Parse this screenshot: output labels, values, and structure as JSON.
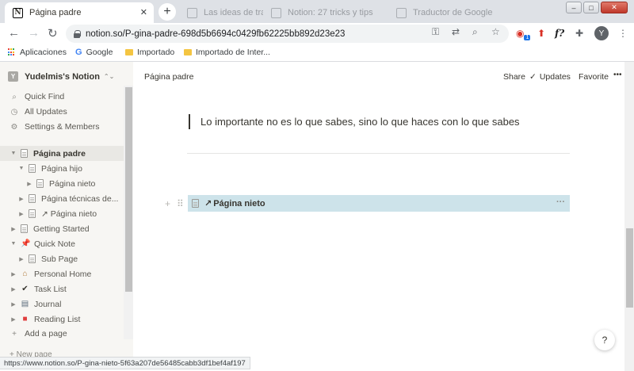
{
  "browser": {
    "active_tab": {
      "title": "Página padre",
      "favicon": "N"
    },
    "inactive_tabs": [
      {
        "title": "Las ideas de trabajo"
      },
      {
        "title": "Notion: 27 tricks y tips"
      },
      {
        "title": "Traductor de Google"
      }
    ],
    "new_tab_label": "+",
    "address": "notion.so/P-gina-padre-698d5b6694c0429fb62225bb892d23e23",
    "avatar_letter": "Y",
    "extension_f_label": "f?",
    "extension_badge": "1",
    "bookmarks": [
      {
        "label": "Aplicaciones",
        "icon": "apps-grid-icon"
      },
      {
        "label": "Google",
        "icon": "google-icon"
      },
      {
        "label": "Importado",
        "icon": "folder-icon"
      },
      {
        "label": "Importado de Inter...",
        "icon": "folder-icon"
      }
    ],
    "status_url": "https://www.notion.so/P-gina-nieto-5f63a207de56485cabb3df1bef4af197"
  },
  "sidebar": {
    "workspace_badge": "Y",
    "workspace_name": "Yudelmis's Notion",
    "links": [
      {
        "label": "Quick Find",
        "icon": "search-icon"
      },
      {
        "label": "All Updates",
        "icon": "clock-icon"
      },
      {
        "label": "Settings & Members",
        "icon": "gear-icon"
      }
    ],
    "tree": [
      {
        "label": "Página padre"
      },
      {
        "label": "Página hijo"
      },
      {
        "label": "Página nieto"
      },
      {
        "label": "Página técnicas de..."
      },
      {
        "label": "↗ Página nieto"
      },
      {
        "label": "Getting Started"
      },
      {
        "label": "Quick Note"
      },
      {
        "label": "Sub Page"
      },
      {
        "label": "Personal Home"
      },
      {
        "label": "Task List"
      },
      {
        "label": "Journal"
      },
      {
        "label": "Reading List"
      }
    ],
    "add_page_label": "Add a page",
    "new_page_label": "New page"
  },
  "topbar": {
    "breadcrumb": "Página padre",
    "share_label": "Share",
    "updates_label": "Updates",
    "favorite_label": "Favorite",
    "more_label": "•••"
  },
  "page": {
    "quote": "Lo importante no es lo que sabes, sino lo que haces con lo que sabes",
    "link_block_title": "Página nieto",
    "link_block_more": "···",
    "help_label": "?"
  },
  "colors": {
    "sidebar_bg": "#f7f6f3",
    "selected_block": "#cde3ea",
    "tab_strip": "#dee1e6",
    "quick_note_pin": "#e03e3e",
    "reading_list_book": "#e03e3e"
  }
}
